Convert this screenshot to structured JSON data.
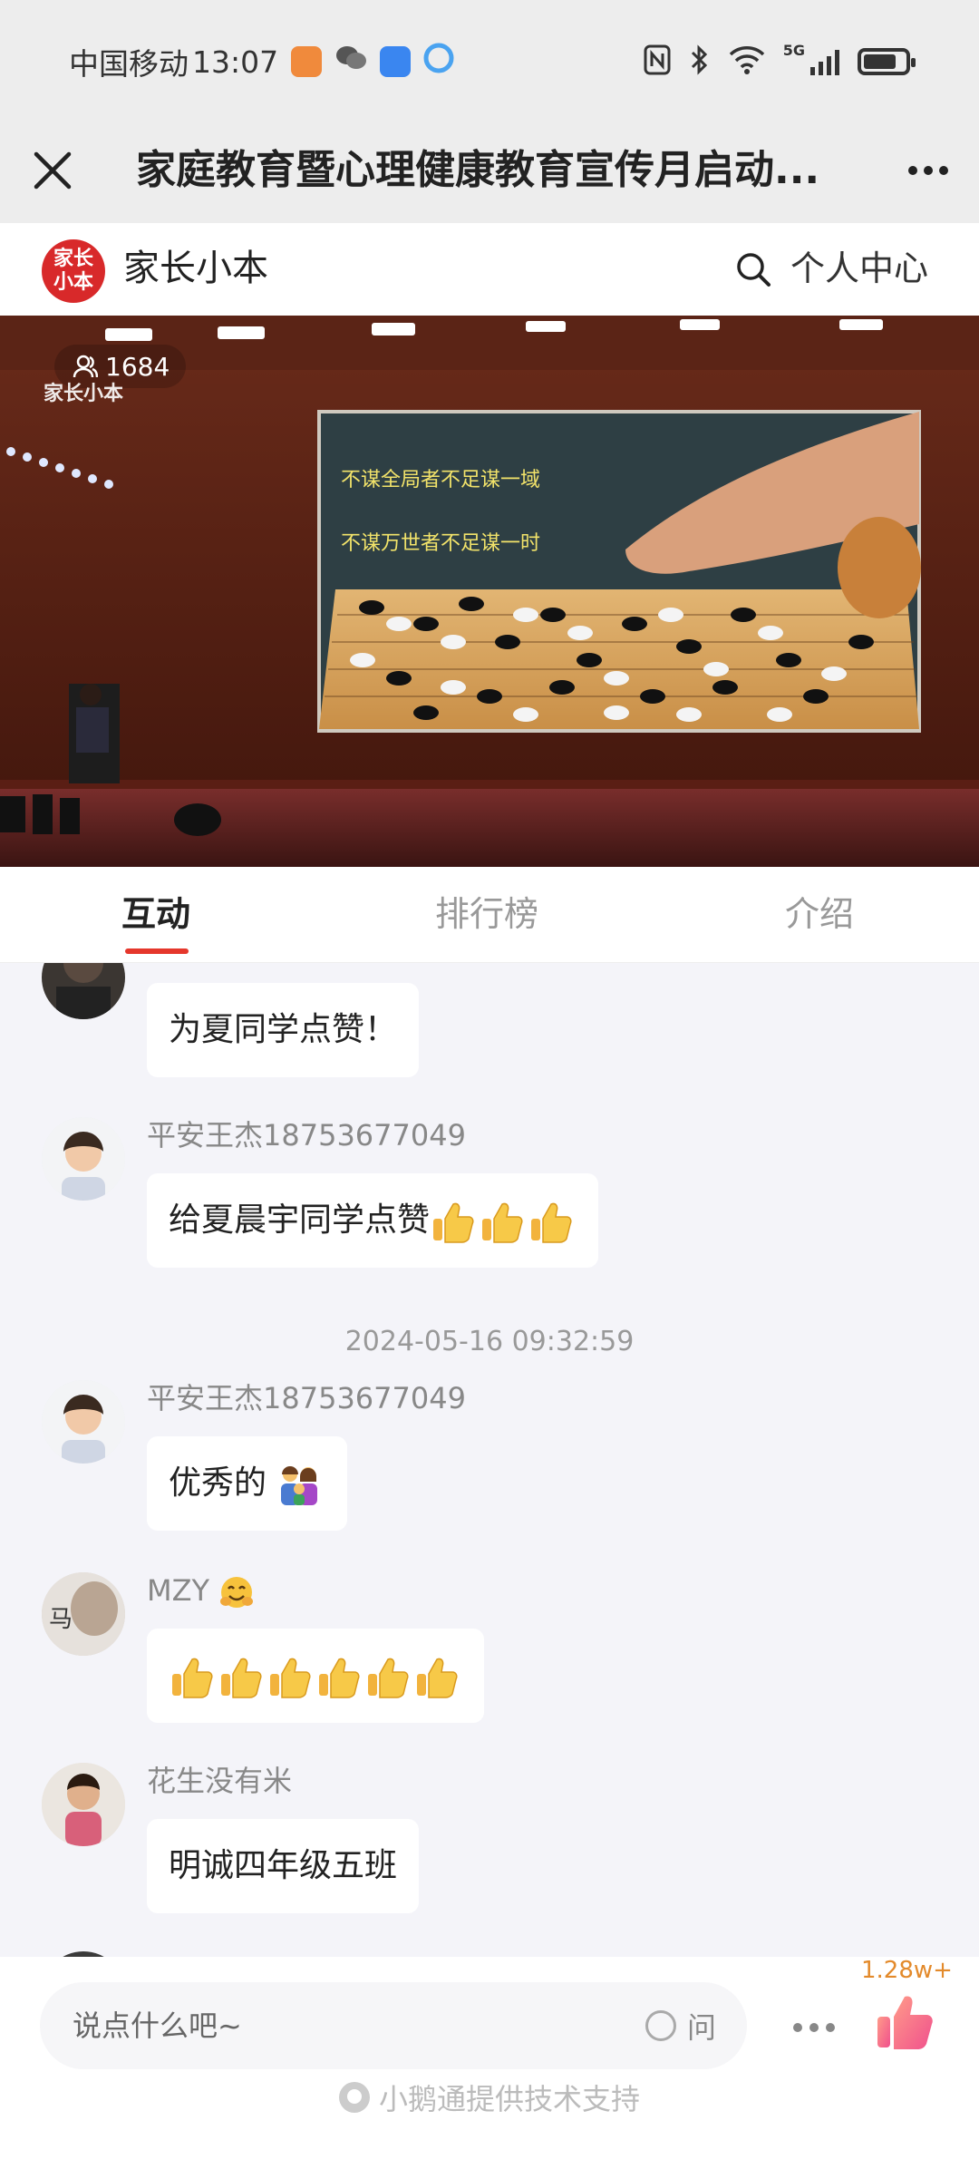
{
  "status_bar": {
    "carrier": "中国移动",
    "time": "13:07",
    "network": "5G"
  },
  "title_bar": {
    "title": "家庭教育暨心理健康教育宣传月启动..."
  },
  "brand": {
    "logo_line1": "家长",
    "logo_line2": "小本",
    "name": "家长小本",
    "user_center": "个人中心"
  },
  "video": {
    "viewer_count": "1684",
    "watermark": "家长小本",
    "screen_line1": "不谋全局者不足谋一域",
    "screen_line2": "不谋万世者不足谋一时"
  },
  "tabs": [
    {
      "label": "互动",
      "active": true
    },
    {
      "label": "排行榜",
      "active": false
    },
    {
      "label": "介绍",
      "active": false
    }
  ],
  "messages": [
    {
      "nick": "",
      "text": "为夏同学点赞！",
      "thumbs": 0,
      "emoji": ""
    },
    {
      "nick": "平安王杰18753677049",
      "text": "给夏晨宇同学点赞",
      "thumbs": 3,
      "emoji": ""
    },
    {
      "nick": "平安王杰18753677049",
      "text": "优秀的",
      "thumbs": 0,
      "emoji": "family"
    },
    {
      "nick": "MZY",
      "text": "",
      "thumbs": 6,
      "emoji": "hug"
    },
    {
      "nick": "花生没有米",
      "text": "明诚四年级五班",
      "thumbs": 0,
      "emoji": ""
    }
  ],
  "timestamp": "2024-05-16 09:32:59",
  "avatar_text_mzy": "马",
  "input": {
    "placeholder": "说点什么吧~",
    "ask_label": "问"
  },
  "likes": {
    "count": "1.28w+"
  },
  "footer": {
    "text": "小鹅通提供技术支持"
  },
  "colors": {
    "accent": "#e5372c",
    "brand_red": "#d8292a",
    "like_orange": "#e38a2b"
  }
}
